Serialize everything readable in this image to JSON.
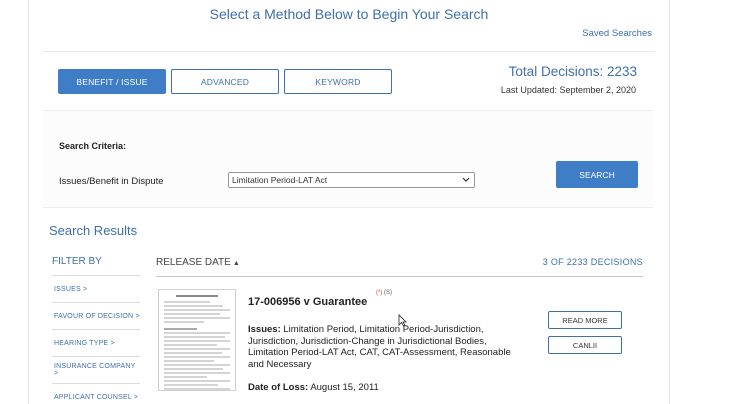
{
  "header": {
    "headline": "Select a Method Below to Begin Your Search",
    "saved_searches": "Saved Searches"
  },
  "tabs": [
    {
      "label": "BENEFIT / ISSUE",
      "active": true
    },
    {
      "label": "ADVANCED",
      "active": false
    },
    {
      "label": "KEYWORD",
      "active": false
    }
  ],
  "stats": {
    "total": "Total Decisions: 2233",
    "updated": "Last Updated: September 2, 2020"
  },
  "criteria": {
    "title": "Search Criteria:",
    "issues_label": "Issues/Benefit in Dispute",
    "selected": "Limitation Period-LAT Act",
    "search_button": "SEARCH"
  },
  "results": {
    "title": "Search Results",
    "filter_by": "FILTER BY",
    "filters": [
      "ISSUES >",
      "FAVOUR OF DECISION >",
      "HEARING TYPE >",
      "INSURANCE COMPANY >",
      "APPLICANT COUNSEL >"
    ],
    "sort_label": "RELEASE DATE",
    "count": "3 OF 2233 DECISIONS",
    "item": {
      "title": "17-006956 v Guarantee",
      "mark_red": "(*)",
      "mark_grey": "(S)",
      "issues_label": "Issues:",
      "issues_text": "Limitation Period, Limitation Period-Jurisdiction, Jurisdiction, Jurisdiction-Change in Jurisdictional Bodies, Limitation Period-LAT Act, CAT, CAT-Assessment, Reasonable and Necessary",
      "dol_label": "Date of Loss:",
      "dol_value": "August 15, 2011",
      "read_more": "READ MORE",
      "canlii": "CANLII"
    }
  },
  "colors": {
    "accent": "#3f6fad",
    "button": "#3f7dc6"
  }
}
